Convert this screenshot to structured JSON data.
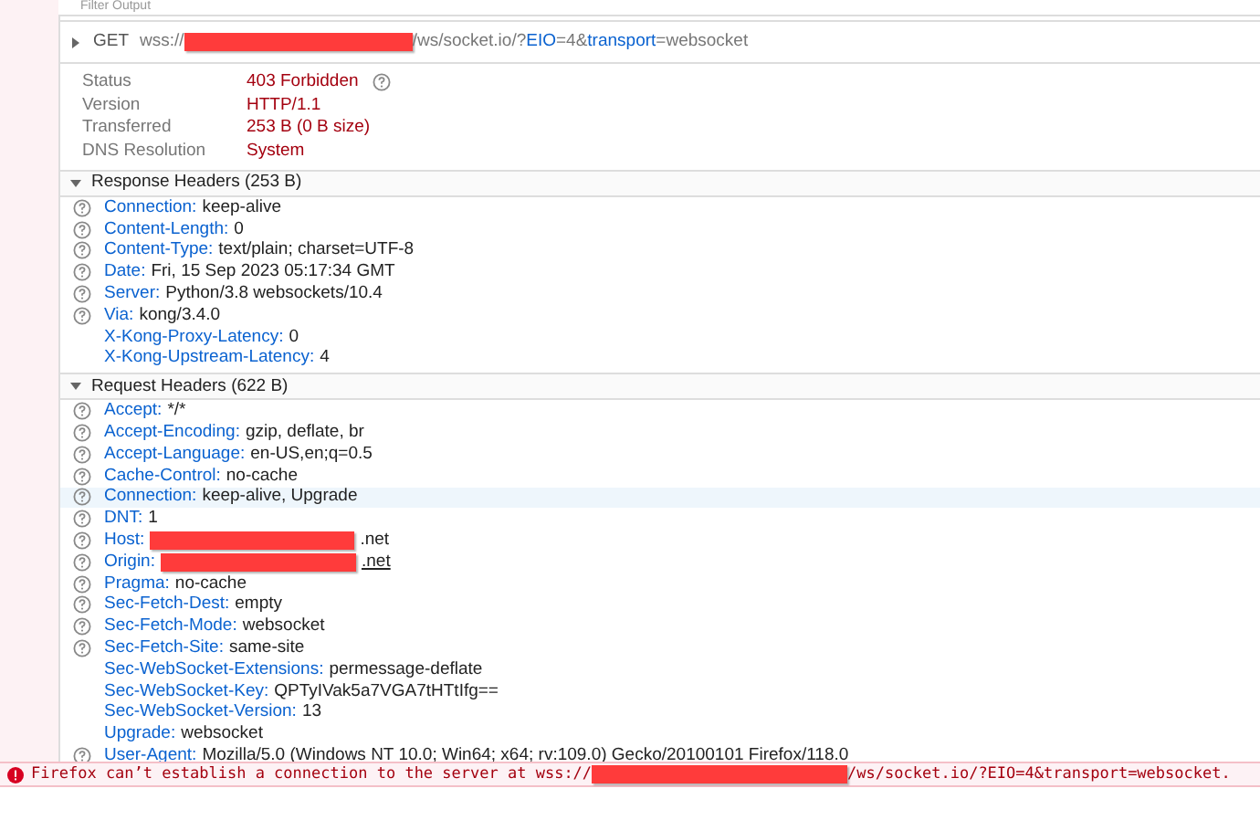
{
  "toolbar": {
    "filter_placeholder": "Filter Output"
  },
  "request": {
    "method": "GET",
    "expanded": false,
    "url": [
      {
        "kind": "text",
        "text": "wss://"
      },
      {
        "kind": "redacted"
      },
      {
        "kind": "text",
        "text": "/ws/socket.io/?"
      },
      {
        "kind": "param",
        "text": "EIO"
      },
      {
        "kind": "text",
        "text": "=4&"
      },
      {
        "kind": "param",
        "text": "transport"
      },
      {
        "kind": "text",
        "text": "=websocket"
      }
    ]
  },
  "summary": [
    {
      "label": "Status",
      "value": "403 Forbidden",
      "help": true
    },
    {
      "label": "Version",
      "value": "HTTP/1.1",
      "help": false
    },
    {
      "label": "Transferred",
      "value": "253 B (0 B size)",
      "help": false
    },
    {
      "label": "DNS Resolution",
      "value": "System",
      "help": false
    }
  ],
  "sections": [
    {
      "title": "Response Headers (253 B)",
      "expanded": true,
      "headers": [
        {
          "name": "Connection:",
          "help": true,
          "selected": false,
          "value": [
            {
              "kind": "text",
              "text": "keep-alive"
            }
          ]
        },
        {
          "name": "Content-Length:",
          "help": true,
          "selected": false,
          "value": [
            {
              "kind": "text",
              "text": "0"
            }
          ]
        },
        {
          "name": "Content-Type:",
          "help": true,
          "selected": false,
          "value": [
            {
              "kind": "text",
              "text": "text/plain; charset=UTF-8"
            }
          ]
        },
        {
          "name": "Date:",
          "help": true,
          "selected": false,
          "value": [
            {
              "kind": "text",
              "text": "Fri, 15 Sep 2023 05:17:34 GMT"
            }
          ]
        },
        {
          "name": "Server:",
          "help": true,
          "selected": false,
          "value": [
            {
              "kind": "text",
              "text": "Python/3.8 websockets/10.4"
            }
          ]
        },
        {
          "name": "Via:",
          "help": true,
          "selected": false,
          "value": [
            {
              "kind": "text",
              "text": "kong/3.4.0"
            }
          ]
        },
        {
          "name": "X-Kong-Proxy-Latency:",
          "help": false,
          "selected": false,
          "value": [
            {
              "kind": "text",
              "text": "0"
            }
          ]
        },
        {
          "name": "X-Kong-Upstream-Latency:",
          "help": false,
          "selected": false,
          "value": [
            {
              "kind": "text",
              "text": "4"
            }
          ]
        }
      ]
    },
    {
      "title": "Request Headers (622 B)",
      "expanded": true,
      "headers": [
        {
          "name": "Accept:",
          "help": true,
          "selected": false,
          "value": [
            {
              "kind": "text",
              "text": "*/*"
            }
          ]
        },
        {
          "name": "Accept-Encoding:",
          "help": true,
          "selected": false,
          "value": [
            {
              "kind": "text",
              "text": "gzip, deflate, br"
            }
          ]
        },
        {
          "name": "Accept-Language:",
          "help": true,
          "selected": false,
          "value": [
            {
              "kind": "text",
              "text": "en-US,en;q=0.5"
            }
          ]
        },
        {
          "name": "Cache-Control:",
          "help": true,
          "selected": false,
          "value": [
            {
              "kind": "text",
              "text": "no-cache"
            }
          ]
        },
        {
          "name": "Connection:",
          "help": true,
          "selected": true,
          "value": [
            {
              "kind": "text",
              "text": "keep-alive, Upgrade"
            }
          ]
        },
        {
          "name": "DNT:",
          "help": true,
          "selected": false,
          "value": [
            {
              "kind": "text",
              "text": "1"
            }
          ]
        },
        {
          "name": "Host:",
          "help": true,
          "selected": false,
          "value": [
            {
              "kind": "redacted"
            },
            {
              "kind": "text",
              "text": ".net"
            }
          ]
        },
        {
          "name": "Origin:",
          "help": true,
          "selected": false,
          "value": [
            {
              "kind": "redacted"
            },
            {
              "kind": "link",
              "text": ".net"
            }
          ]
        },
        {
          "name": "Pragma:",
          "help": true,
          "selected": false,
          "value": [
            {
              "kind": "text",
              "text": "no-cache"
            }
          ]
        },
        {
          "name": "Sec-Fetch-Dest:",
          "help": true,
          "selected": false,
          "value": [
            {
              "kind": "text",
              "text": "empty"
            }
          ]
        },
        {
          "name": "Sec-Fetch-Mode:",
          "help": true,
          "selected": false,
          "value": [
            {
              "kind": "text",
              "text": "websocket"
            }
          ]
        },
        {
          "name": "Sec-Fetch-Site:",
          "help": true,
          "selected": false,
          "value": [
            {
              "kind": "text",
              "text": "same-site"
            }
          ]
        },
        {
          "name": "Sec-WebSocket-Extensions:",
          "help": false,
          "selected": false,
          "value": [
            {
              "kind": "text",
              "text": "permessage-deflate"
            }
          ]
        },
        {
          "name": "Sec-WebSocket-Key:",
          "help": false,
          "selected": false,
          "value": [
            {
              "kind": "text",
              "text": "QPTyIVak5a7VGA7tHTtIfg=="
            }
          ]
        },
        {
          "name": "Sec-WebSocket-Version:",
          "help": false,
          "selected": false,
          "value": [
            {
              "kind": "text",
              "text": "13"
            }
          ]
        },
        {
          "name": "Upgrade:",
          "help": false,
          "selected": false,
          "value": [
            {
              "kind": "text",
              "text": "websocket"
            }
          ]
        },
        {
          "name": "User-Agent:",
          "help": true,
          "selected": false,
          "value": [
            {
              "kind": "text",
              "text": "Mozilla/5.0 (Windows NT 10.0; Win64; x64; rv:109.0) Gecko/20100101 Firefox/118.0"
            }
          ]
        }
      ]
    }
  ],
  "console": [
    {
      "kind": "error",
      "parts": [
        {
          "kind": "text",
          "text": "Firefox can’t establish a connection to the server at wss://"
        },
        {
          "kind": "redacted"
        },
        {
          "kind": "text",
          "text": "/ws/socket.io/?EIO=4&transport=websocket."
        }
      ]
    }
  ]
}
